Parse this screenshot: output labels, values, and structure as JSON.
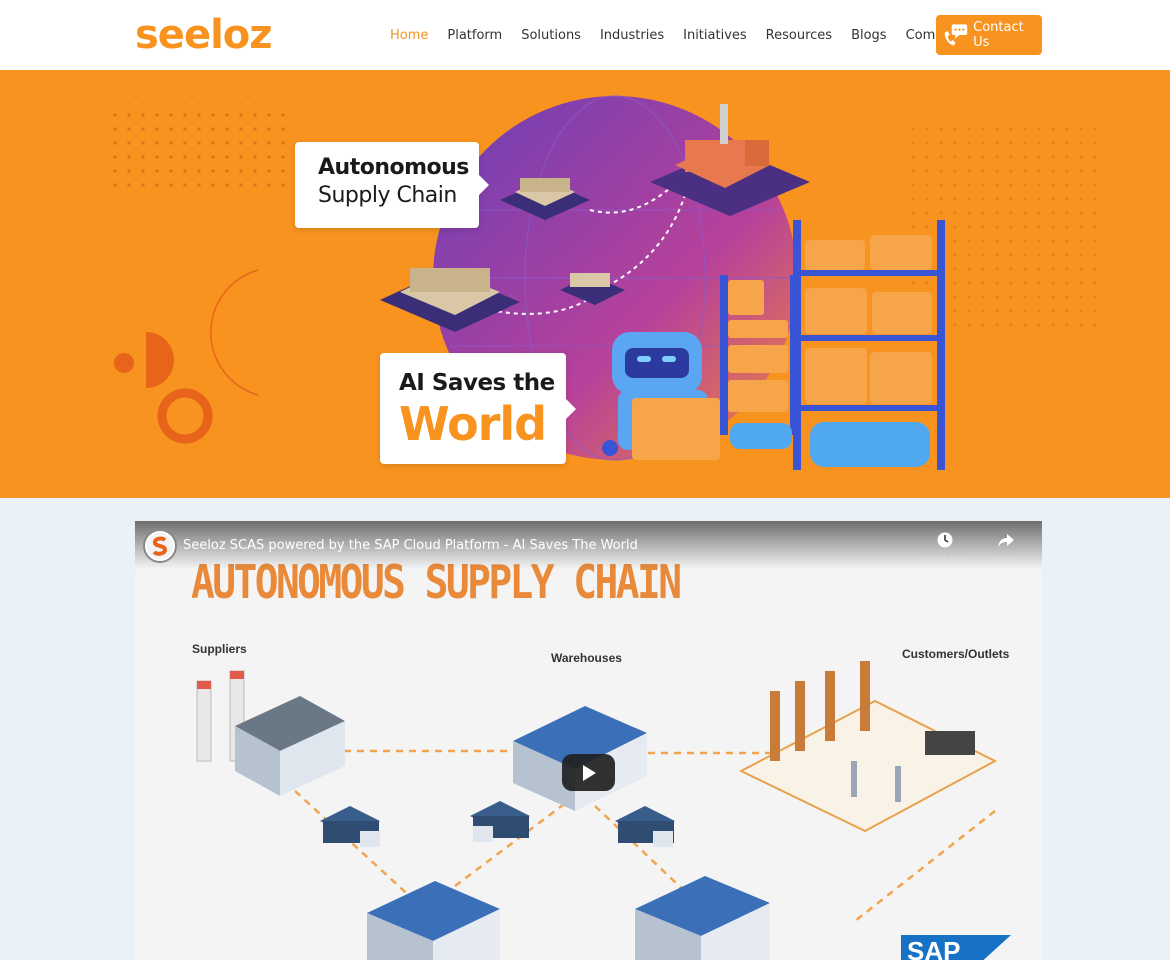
{
  "brand": {
    "logo_text": "seeloz",
    "accent_color": "#f7931e"
  },
  "nav": {
    "items": [
      "Home",
      "Platform",
      "Solutions",
      "Industries",
      "Initiatives",
      "Resources",
      "Blogs",
      "Company"
    ],
    "active": "Home",
    "contact_label": "Contact Us"
  },
  "hero": {
    "callout1": {
      "line1": "Autonomous",
      "line2": "Supply Chain"
    },
    "callout2": {
      "line1": "AI Saves the",
      "line2": "World"
    }
  },
  "video": {
    "title": "Seeloz SCAS powered by the SAP Cloud Platform - AI Saves The World",
    "watch_later_label": "Watch later",
    "share_label": "Share",
    "heading": "AUTONOMOUS SUPPLY CHAIN",
    "labels": {
      "suppliers": "Suppliers",
      "warehouses": "Warehouses",
      "customers": "Customers/Outlets"
    },
    "sap_text": "SAP"
  }
}
